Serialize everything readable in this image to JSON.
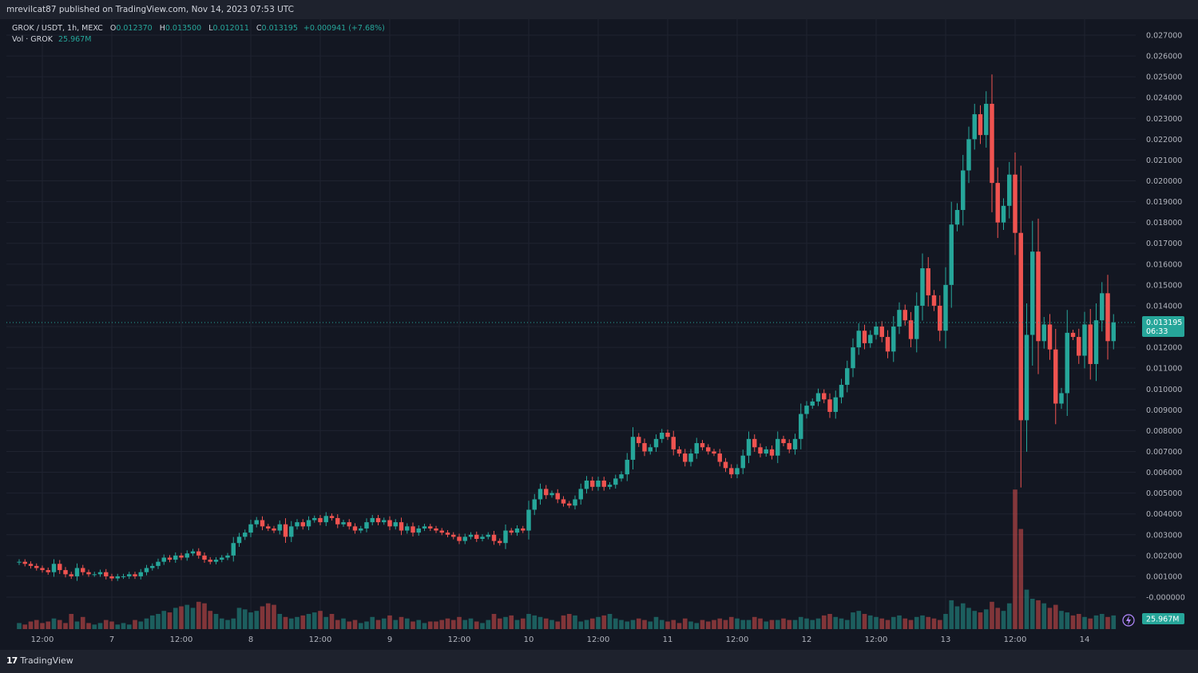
{
  "header": {
    "published": "mrevilcat87 published on TradingView.com, Nov 14, 2023 07:53 UTC"
  },
  "legend": {
    "symbol": "GROK / USDT, 1h, MEXC",
    "o_label": "O",
    "o_value": "0.012370",
    "h_label": "H",
    "h_value": "0.013500",
    "l_label": "L",
    "l_value": "0.012011",
    "c_label": "C",
    "c_value": "0.013195",
    "change": "+0.000941 (+7.68%)",
    "vol_label": "Vol · GROK",
    "vol_value": "25.967M"
  },
  "footer": {
    "brand": "TradingView"
  },
  "colors": {
    "up": "#26a69a",
    "down": "#ef5350",
    "bg": "#131722",
    "grid": "#1f2330"
  },
  "chart_data": {
    "type": "candlestick",
    "symbol": "GROK / USDT",
    "interval": "1h",
    "exchange": "MEXC",
    "y_axis_ticks": [
      "0.027000",
      "0.026000",
      "0.025000",
      "0.024000",
      "0.023000",
      "0.022000",
      "0.021000",
      "0.020000",
      "0.019000",
      "0.018000",
      "0.017000",
      "0.016000",
      "0.015000",
      "0.014000",
      "0.013000",
      "0.012000",
      "0.011000",
      "0.010000",
      "0.009000",
      "0.008000",
      "0.007000",
      "0.006000",
      "0.005000",
      "0.004000",
      "0.003000",
      "0.002000",
      "0.001000",
      "-0.000000"
    ],
    "x_axis_ticks": [
      "12:00",
      "7",
      "12:00",
      "8",
      "12:00",
      "9",
      "12:00",
      "10",
      "12:00",
      "11",
      "12:00",
      "12",
      "12:00",
      "13",
      "12:00",
      "14"
    ],
    "ylim": [
      -0.0015,
      0.0277
    ],
    "last_price": "0.013195",
    "countdown": "06:33",
    "volume_last": "25.967M",
    "candles_per_12h": 12,
    "closes": [
      0.0017,
      0.0016,
      0.0015,
      0.0014,
      0.0013,
      0.0012,
      0.0016,
      0.0013,
      0.0011,
      0.001,
      0.0014,
      0.0012,
      0.0011,
      0.0011,
      0.0012,
      0.001,
      0.0009,
      0.001,
      0.001,
      0.0011,
      0.001,
      0.0012,
      0.0014,
      0.0015,
      0.0017,
      0.0019,
      0.0018,
      0.002,
      0.0019,
      0.0021,
      0.0022,
      0.002,
      0.0018,
      0.0017,
      0.0018,
      0.0019,
      0.002,
      0.0026,
      0.0029,
      0.0031,
      0.0035,
      0.0037,
      0.0034,
      0.0033,
      0.0032,
      0.0035,
      0.0029,
      0.0034,
      0.0036,
      0.0034,
      0.0037,
      0.0038,
      0.0036,
      0.0039,
      0.0038,
      0.0035,
      0.0036,
      0.0034,
      0.0032,
      0.0033,
      0.0036,
      0.0038,
      0.0036,
      0.0037,
      0.0034,
      0.0036,
      0.0032,
      0.0034,
      0.0031,
      0.0033,
      0.0034,
      0.0033,
      0.0032,
      0.0031,
      0.003,
      0.0029,
      0.0027,
      0.0029,
      0.003,
      0.0028,
      0.0029,
      0.003,
      0.0027,
      0.0026,
      0.0032,
      0.0031,
      0.0033,
      0.0032,
      0.0042,
      0.0047,
      0.0052,
      0.0049,
      0.005,
      0.0047,
      0.0045,
      0.0044,
      0.0047,
      0.0052,
      0.0056,
      0.0053,
      0.0056,
      0.0053,
      0.0054,
      0.0057,
      0.0059,
      0.0066,
      0.0077,
      0.0074,
      0.007,
      0.0072,
      0.0076,
      0.0079,
      0.0077,
      0.0071,
      0.0069,
      0.0065,
      0.0069,
      0.0074,
      0.0072,
      0.007,
      0.0069,
      0.0065,
      0.0062,
      0.0059,
      0.0062,
      0.0068,
      0.0076,
      0.0072,
      0.0069,
      0.0071,
      0.0068,
      0.0076,
      0.0074,
      0.0071,
      0.0076,
      0.0088,
      0.0092,
      0.0094,
      0.0098,
      0.0095,
      0.0089,
      0.0096,
      0.0102,
      0.011,
      0.012,
      0.0128,
      0.0122,
      0.0126,
      0.013,
      0.0125,
      0.0118,
      0.013,
      0.0138,
      0.0133,
      0.0124,
      0.014,
      0.0158,
      0.0145,
      0.014,
      0.0128,
      0.015,
      0.0179,
      0.0186,
      0.0205,
      0.022,
      0.0232,
      0.0222,
      0.0237,
      0.0199,
      0.018,
      0.0188,
      0.0203,
      0.0175,
      0.0085,
      0.0126,
      0.0166,
      0.0123,
      0.0131,
      0.0119,
      0.0093,
      0.0098,
      0.0127,
      0.0125,
      0.0116,
      0.0131,
      0.0112,
      0.0133,
      0.0146,
      0.0123,
      0.0132
    ],
    "volume_relative": [
      0.2,
      0.15,
      0.25,
      0.3,
      0.2,
      0.25,
      0.35,
      0.3,
      0.2,
      0.5,
      0.25,
      0.4,
      0.2,
      0.15,
      0.2,
      0.3,
      0.25,
      0.15,
      0.2,
      0.15,
      0.3,
      0.25,
      0.35,
      0.45,
      0.5,
      0.6,
      0.55,
      0.7,
      0.75,
      0.8,
      0.7,
      0.9,
      0.85,
      0.6,
      0.5,
      0.35,
      0.3,
      0.35,
      0.7,
      0.65,
      0.55,
      0.6,
      0.75,
      0.85,
      0.8,
      0.5,
      0.4,
      0.35,
      0.4,
      0.45,
      0.5,
      0.55,
      0.6,
      0.4,
      0.5,
      0.3,
      0.35,
      0.25,
      0.3,
      0.2,
      0.25,
      0.4,
      0.3,
      0.35,
      0.45,
      0.3,
      0.4,
      0.35,
      0.25,
      0.3,
      0.2,
      0.25,
      0.25,
      0.3,
      0.35,
      0.3,
      0.4,
      0.3,
      0.35,
      0.25,
      0.2,
      0.3,
      0.5,
      0.35,
      0.4,
      0.45,
      0.3,
      0.35,
      0.5,
      0.45,
      0.4,
      0.35,
      0.3,
      0.25,
      0.45,
      0.5,
      0.45,
      0.25,
      0.3,
      0.35,
      0.4,
      0.45,
      0.5,
      0.35,
      0.3,
      0.25,
      0.3,
      0.35,
      0.3,
      0.25,
      0.4,
      0.3,
      0.25,
      0.3,
      0.2,
      0.35,
      0.25,
      0.2,
      0.3,
      0.25,
      0.3,
      0.35,
      0.3,
      0.4,
      0.35,
      0.3,
      0.3,
      0.4,
      0.35,
      0.25,
      0.3,
      0.3,
      0.35,
      0.3,
      0.3,
      0.4,
      0.35,
      0.3,
      0.35,
      0.45,
      0.5,
      0.4,
      0.35,
      0.3,
      0.55,
      0.6,
      0.5,
      0.45,
      0.4,
      0.35,
      0.3,
      0.4,
      0.45,
      0.35,
      0.3,
      0.4,
      0.45,
      0.4,
      0.35,
      0.3,
      0.5,
      0.95,
      0.75,
      0.85,
      0.7,
      0.6,
      0.55,
      0.65,
      0.9,
      0.7,
      0.6,
      0.85,
      4.6,
      3.3,
      1.3,
      1.0,
      0.95,
      0.85,
      0.7,
      0.8,
      0.6,
      0.55,
      0.45,
      0.5,
      0.4,
      0.35,
      0.45,
      0.5,
      0.4,
      0.45
    ]
  }
}
